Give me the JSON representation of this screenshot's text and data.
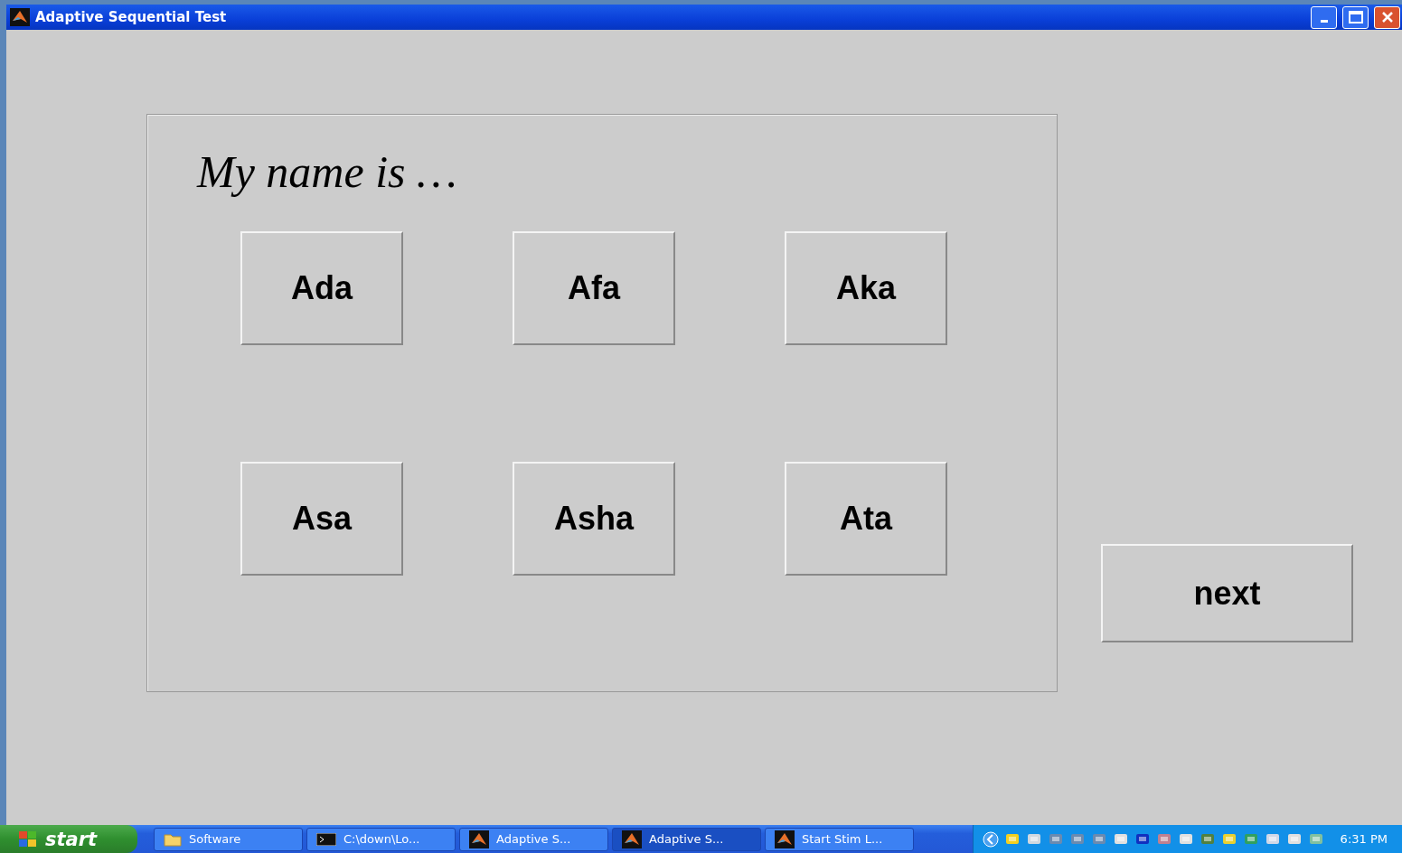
{
  "window": {
    "title": "Adaptive Sequential Test"
  },
  "prompt": "My name is …",
  "name_buttons": [
    "Ada",
    "Afa",
    "Aka",
    "Asa",
    "Asha",
    "Ata"
  ],
  "next_button": "next",
  "taskbar": {
    "start": "start",
    "tasks": [
      {
        "label": "Software",
        "kind": "folder",
        "selected": false
      },
      {
        "label": "C:\\down\\Lo...",
        "kind": "console",
        "selected": false
      },
      {
        "label": "Adaptive S...",
        "kind": "app",
        "selected": false
      },
      {
        "label": "Adaptive S...",
        "kind": "app",
        "selected": true
      },
      {
        "label": "Start Stim L...",
        "kind": "app",
        "selected": false
      }
    ],
    "clock": "6:31 PM"
  }
}
